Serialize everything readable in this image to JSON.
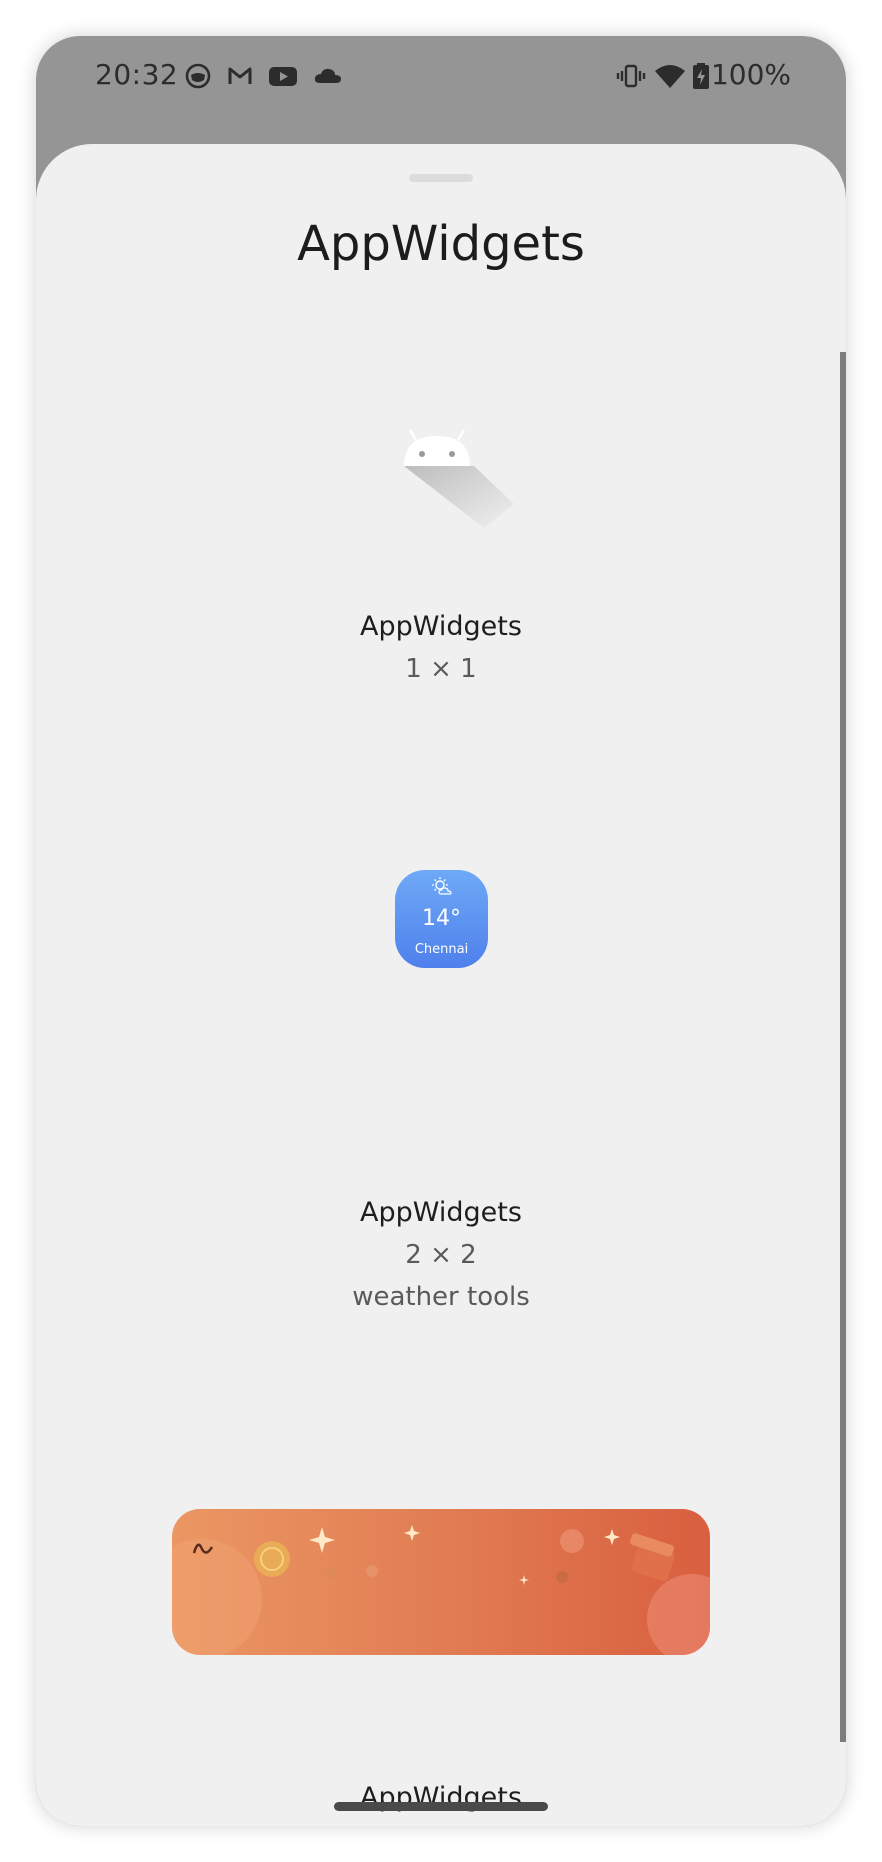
{
  "status_bar": {
    "time": "20:32",
    "battery": "100%",
    "left_icons": [
      "face-mask-icon",
      "gmail-icon",
      "youtube-icon",
      "cloud-icon"
    ],
    "right_icons": [
      "vibrate-icon",
      "wifi-icon",
      "battery-charging-icon"
    ]
  },
  "sheet": {
    "title": "AppWidgets",
    "widgets": [
      {
        "name": "AppWidgets",
        "size": "1 × 1",
        "preview": "android-robot-icon"
      },
      {
        "name": "AppWidgets",
        "size": "2 × 2",
        "description": "weather tools",
        "preview": {
          "temp": "14°",
          "city": "Chennai"
        }
      },
      {
        "name": "AppWidgets",
        "preview": "promo-banner"
      }
    ]
  },
  "colors": {
    "sheet_bg": "#f0f0f0",
    "weather_blue": "#5a8ff0",
    "banner_orange": "#e07a52"
  }
}
